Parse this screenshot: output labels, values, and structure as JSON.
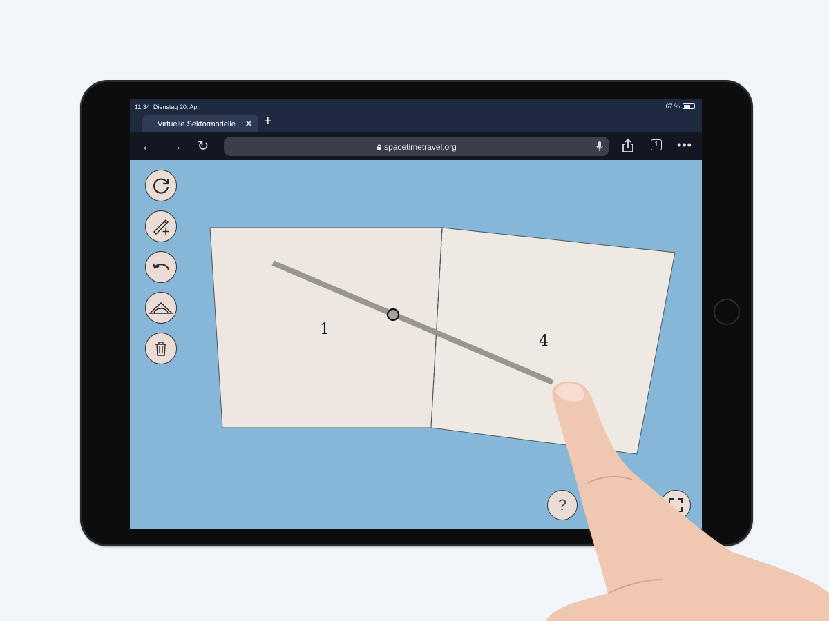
{
  "status_bar": {
    "time": "11:34",
    "date": "Dienstag 20. Apr.",
    "battery": "67 %",
    "battery_level": 0.67
  },
  "browser": {
    "tab_title": "Virtuelle Sektormodelle",
    "tab_close": "✕",
    "new_tab": "+",
    "back": "←",
    "forward": "→",
    "reload": "↻",
    "url": "spacetimetravel.org",
    "tab_count": "1",
    "more": "•••"
  },
  "app": {
    "sidebar_tools": [
      "reset-icon",
      "draw-line-icon",
      "undo-icon",
      "protractor-icon",
      "trash-icon"
    ],
    "sectors": [
      {
        "label": "1"
      },
      {
        "label": "4"
      }
    ],
    "help_label": "?",
    "colors": {
      "background": "#86b7d8",
      "sector": "#ede6e1",
      "line": "#9b968c",
      "button": "#e9ddd6"
    }
  }
}
